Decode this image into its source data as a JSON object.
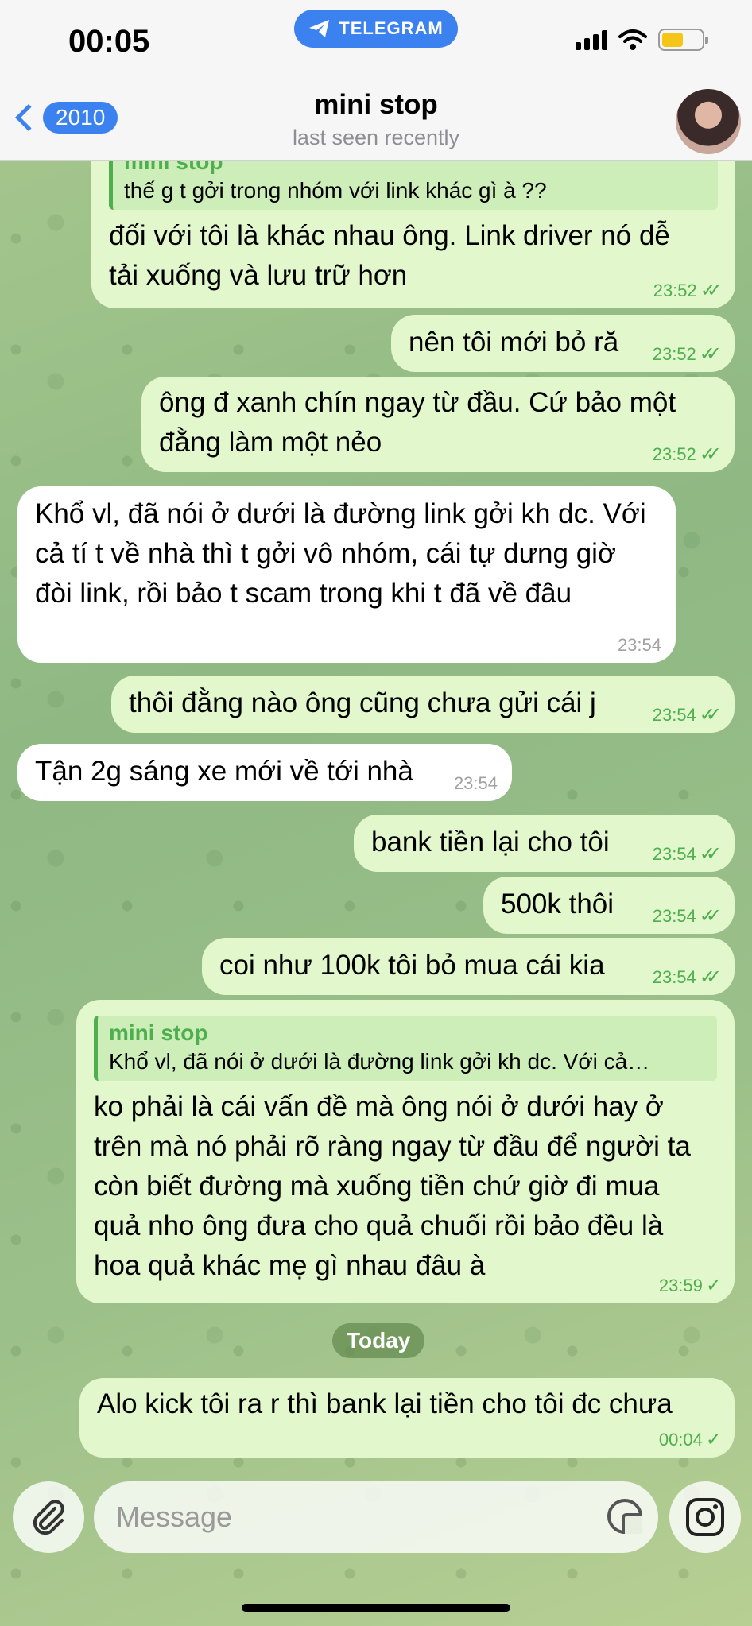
{
  "status_bar": {
    "time": "00:05",
    "app_pill": "TELEGRAM"
  },
  "header": {
    "back_count": "2010",
    "title": "mini stop",
    "subtitle": "last seen recently"
  },
  "messages": [
    {
      "dir": "out",
      "reply_name": "mini stop",
      "reply_text": "thế g t gởi trong nhóm với link khác gì à ??",
      "text": "đối với tôi là khác nhau ông. Link driver nó dễ tải xuống và lưu trữ hơn",
      "time": "23:52",
      "status": "read"
    },
    {
      "dir": "out",
      "text": "nên tôi mới bỏ ră",
      "time": "23:52",
      "status": "read"
    },
    {
      "dir": "out",
      "text": "ông đ xanh chín ngay từ đầu. Cứ bảo một đằng làm một nẻo",
      "time": "23:52",
      "status": "read"
    },
    {
      "dir": "in",
      "text": "Khổ vl, đã nói ở dưới là đường link gởi kh dc. Với cả tí t về nhà thì t gởi vô nhóm, cái tự dưng giờ đòi link, rồi bảo t scam trong khi t đã về đâu",
      "time": "23:54"
    },
    {
      "dir": "out",
      "text": "thôi đằng nào ông cũng chưa gửi cái j",
      "time": "23:54",
      "status": "read"
    },
    {
      "dir": "in",
      "text": "Tận 2g sáng xe mới về tới nhà",
      "time": "23:54"
    },
    {
      "dir": "out",
      "text": "bank tiền lại cho tôi",
      "time": "23:54",
      "status": "read"
    },
    {
      "dir": "out",
      "text": "500k thôi",
      "time": "23:54",
      "status": "read"
    },
    {
      "dir": "out",
      "text": "coi như 100k tôi bỏ mua cái kia",
      "time": "23:54",
      "status": "read"
    },
    {
      "dir": "out",
      "reply_name": "mini stop",
      "reply_text": "Khổ vl, đã nói ở dưới là đường link gởi kh dc. Với cả…",
      "text": "ko phải là cái vấn đề mà ông nói ở dưới hay ở trên mà nó phải rõ ràng ngay từ đầu để người ta còn biết đường mà xuống tiền chứ giờ đi mua quả nho ông đưa cho quả chuối rồi bảo đều là hoa quả khác mẹ gì nhau đâu à",
      "time": "23:59",
      "status": "sent"
    },
    {
      "dir": "out",
      "text": "Alo kick tôi ra r thì bank lại tiền cho tôi đc chưa",
      "time": "00:04",
      "status": "sent"
    }
  ],
  "date_divider": "Today",
  "composer": {
    "placeholder": "Message"
  },
  "colors": {
    "accent": "#3b82f0",
    "outgoing_bubble": "#e2f7cb",
    "incoming_bubble": "#ffffff",
    "read_check": "#4fae4e"
  }
}
